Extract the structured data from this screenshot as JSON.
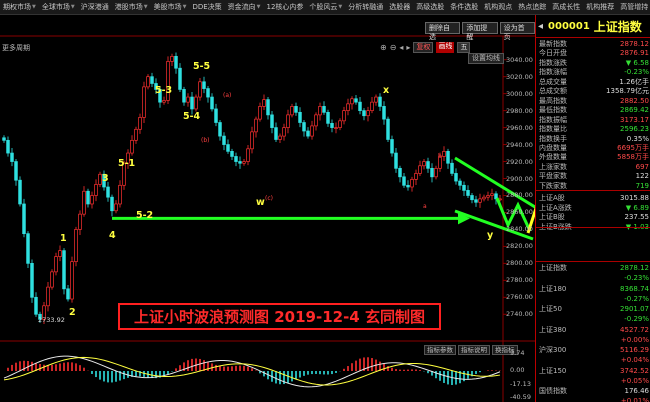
{
  "menu": [
    {
      "label": "期权市场",
      "caret": true
    },
    {
      "label": "全球市场",
      "caret": true
    },
    {
      "label": "沪深港通",
      "caret": false
    },
    {
      "label": "港股市场",
      "caret": true
    },
    {
      "label": "美股市场",
      "caret": true
    },
    {
      "label": "DDE决策",
      "caret": false
    },
    {
      "label": "资金流向",
      "caret": true
    },
    {
      "label": "12核心内参",
      "caret": false
    },
    {
      "label": "个股风云",
      "caret": true
    },
    {
      "label": "分析转融通",
      "caret": false
    },
    {
      "label": "选股器",
      "caret": false
    },
    {
      "label": "高级选股",
      "caret": false
    },
    {
      "label": "条件选股",
      "caret": false
    },
    {
      "label": "机构观点",
      "caret": false
    },
    {
      "label": "热点追踪",
      "caret": false
    },
    {
      "label": "高成长性",
      "caret": false
    },
    {
      "label": "机构推荐",
      "caret": false
    },
    {
      "label": "高管增持",
      "caret": false
    }
  ],
  "chart_buttons": {
    "add": "删除自选",
    "save": "添加提醒",
    "compare": "设为首页"
  },
  "period_label": "更多周期",
  "toolbar": {
    "fuquan": "复权",
    "tag_red": "画线",
    "tag_dark": "五",
    "icons": [
      "⊕",
      "⊖",
      "◂",
      "▸"
    ]
  },
  "settings": "设置均线",
  "price_axis": [
    "3040.00",
    "3020.00",
    "3000.00",
    "2980.00",
    "2960.00",
    "2940.00",
    "2920.00",
    "2900.00",
    "2880.00",
    "2860.00",
    "2840.00",
    "2820.00",
    "2800.00",
    "2780.00",
    "2760.00",
    "2740.00"
  ],
  "macd_axis": [
    "9.74",
    "0.00",
    "-17.13",
    "-40.59"
  ],
  "low_marker": "2733.92",
  "waves": {
    "w1": "1",
    "w2": "2",
    "w3": "3",
    "w4": "4",
    "w51": "5-1",
    "w52": "5-2",
    "w53": "5-3",
    "w54": "5-4",
    "w55": "5-5",
    "wx": "x",
    "wy": "y",
    "ww": "w"
  },
  "wave_small": {
    "a": "(a)",
    "b": "(b)",
    "c": "(c)",
    "b2": "b",
    "a2": "a"
  },
  "banner": "上证小时波浪预测图 2019-12-4  玄同制图",
  "macd_tabs": [
    "指标参数",
    "指标说明",
    "换指标"
  ],
  "panel": {
    "code": "000001",
    "name": "上证指数",
    "rows": [
      {
        "label": "最新指数",
        "value": "2878.12",
        "cls": "red"
      },
      {
        "label": "今日开盘",
        "value": "2876.91",
        "cls": "red"
      },
      {
        "label": "指数涨跌",
        "value": "▼ 6.58",
        "cls": "grn"
      },
      {
        "label": "指数涨幅",
        "value": "-0.23%",
        "cls": "grn"
      },
      {
        "label": "总成交量",
        "value": "1.26亿手",
        "cls": "wht"
      },
      {
        "label": "总成交额",
        "value": "1358.79亿元",
        "cls": "wht"
      },
      {
        "label": "最高指数",
        "value": "2882.50",
        "cls": "red"
      },
      {
        "label": "最低指数",
        "value": "2869.42",
        "cls": "grn"
      },
      {
        "label": "指数振幅",
        "value": "3173.17",
        "cls": "red"
      },
      {
        "label": "指数量比",
        "value": "2596.23",
        "cls": "grn"
      },
      {
        "label": "指数换手",
        "value": "0.35%",
        "cls": "wht"
      },
      {
        "label": "内盘数量",
        "value": "6695万手",
        "cls": "red"
      },
      {
        "label": "外盘数量",
        "value": "5858万手",
        "cls": "red"
      },
      {
        "label": "上涨家数",
        "value": "697",
        "cls": "red"
      },
      {
        "label": "平盘家数",
        "value": "122",
        "cls": "wht"
      },
      {
        "label": "下跌家数",
        "value": "719",
        "cls": "grn"
      },
      {
        "label": "上证A股",
        "value": "3015.88",
        "cls": "wht"
      },
      {
        "label": "上证A涨跌",
        "value": "▼ 6.89",
        "cls": "grn"
      },
      {
        "label": "上证B股",
        "value": "237.55",
        "cls": "wht"
      },
      {
        "label": "上证B涨跌",
        "value": "▼ 1.03",
        "cls": "grn"
      },
      {
        "label": "上证指数",
        "value": "2878.12",
        "cls": "grn"
      },
      {
        "label": "",
        "value": "-0.23%",
        "cls": "grn"
      },
      {
        "label": "上证180",
        "value": "8368.74",
        "cls": "grn"
      },
      {
        "label": "",
        "value": "-0.27%",
        "cls": "grn"
      },
      {
        "label": "上证50",
        "value": "2901.07",
        "cls": "grn"
      },
      {
        "label": "",
        "value": "-0.29%",
        "cls": "grn"
      },
      {
        "label": "上证380",
        "value": "4527.72",
        "cls": "red"
      },
      {
        "label": "",
        "value": "+0.00%",
        "cls": "red"
      },
      {
        "label": "沪深300",
        "value": "5116.29",
        "cls": "red"
      },
      {
        "label": "",
        "value": "+0.04%",
        "cls": "red"
      },
      {
        "label": "上证150",
        "value": "3742.52",
        "cls": "red"
      },
      {
        "label": "",
        "value": "+0.05%",
        "cls": "red"
      },
      {
        "label": "国债指数",
        "value": "176.46",
        "cls": "wht"
      },
      {
        "label": "",
        "value": "+0.01%",
        "cls": "red"
      }
    ]
  },
  "colors": {
    "up": "#ff3030",
    "down": "#2fe0e0",
    "wave_label": "#ffff40",
    "forecast": "#22ff22",
    "projection": "#ffff20",
    "banner": "#ff2020"
  },
  "chart_data": {
    "type": "candlestick",
    "title": "上证小时波浪预测图 2019-12-4  玄同制图",
    "ylim": [
      2725,
      3055
    ],
    "price_ticks": [
      3040,
      3020,
      3000,
      2980,
      2960,
      2940,
      2920,
      2900,
      2880,
      2860,
      2840,
      2820,
      2800,
      2780,
      2760,
      2740
    ],
    "path": [
      2945,
      2930,
      2920,
      2898,
      2870,
      2835,
      2800,
      2760,
      2740,
      2734,
      2750,
      2772,
      2790,
      2808,
      2815,
      2770,
      2758,
      2802,
      2840,
      2858,
      2885,
      2870,
      2880,
      2893,
      2905,
      2890,
      2878,
      2862,
      2870,
      2892,
      2918,
      2930,
      2945,
      2958,
      2972,
      3008,
      3020,
      3012,
      3005,
      2990,
      2992,
      3038,
      3044,
      3030,
      3005,
      2990,
      2996,
      2982,
      2996,
      3014,
      3006,
      2996,
      2982,
      2966,
      2950,
      2940,
      2932,
      2926,
      2920,
      2918,
      2920,
      2935,
      2955,
      2970,
      2985,
      2993,
      2975,
      2960,
      2946,
      2950,
      2960,
      2975,
      2985,
      2978,
      2966,
      2956,
      2950,
      2962,
      2975,
      2985,
      2978,
      2965,
      2960,
      2960,
      2968,
      2980,
      2988,
      2994,
      2990,
      2980,
      2974,
      2980,
      2990,
      2996,
      2985,
      2970,
      2946,
      2930,
      2912,
      2902,
      2892,
      2890,
      2899,
      2906,
      2915,
      2920,
      2912,
      2902,
      2912,
      2926,
      2932,
      2918,
      2906,
      2897,
      2892,
      2886,
      2880,
      2875,
      2872,
      2876,
      2878,
      2880,
      2882,
      2876,
      2876
    ],
    "forecast_line": [
      [
        4,
        2853
      ],
      [
        116,
        2853
      ]
    ],
    "projection_start": [
      116,
      2853
    ]
  }
}
